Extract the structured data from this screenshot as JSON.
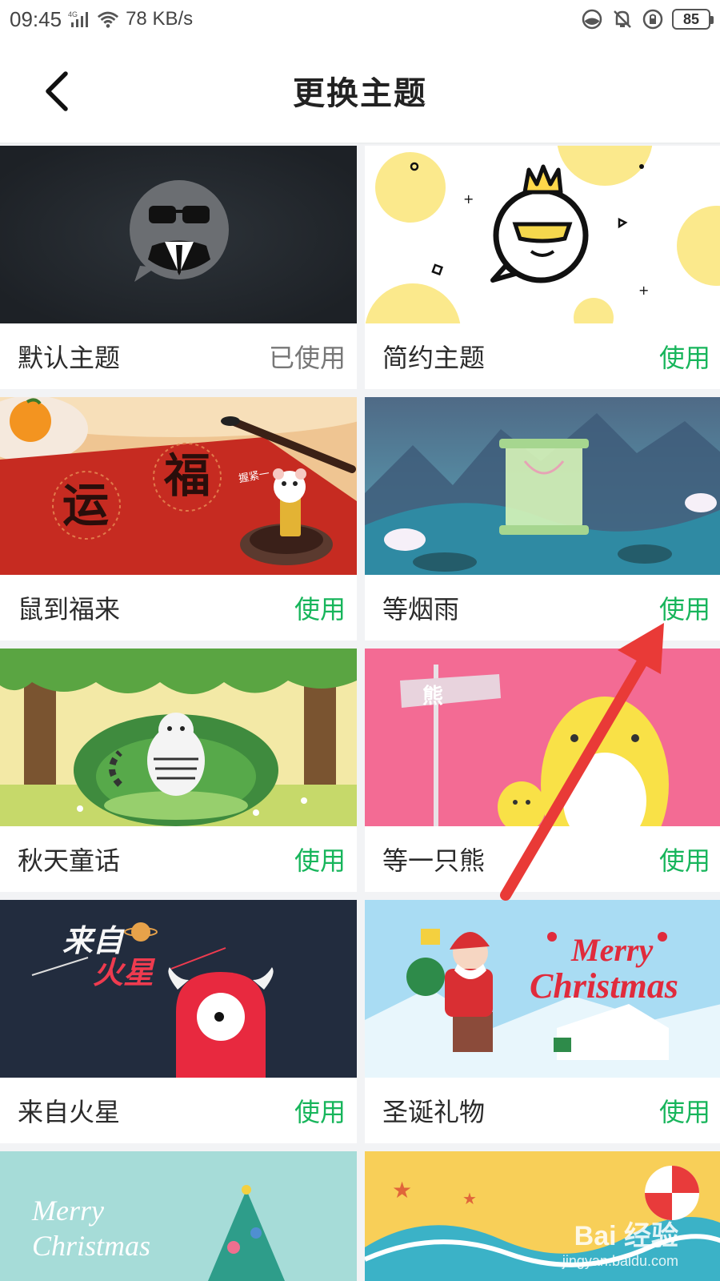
{
  "status": {
    "time": "09:45",
    "network": "4G",
    "speed": "78 KB/s",
    "battery": "85"
  },
  "header": {
    "title": "更换主题"
  },
  "themes": [
    {
      "name": "默认主题",
      "action": "已使用"
    },
    {
      "name": "简约主题",
      "action": "使用"
    },
    {
      "name": "鼠到福来",
      "action": "使用"
    },
    {
      "name": "等烟雨",
      "action": "使用"
    },
    {
      "name": "秋天童话",
      "action": "使用"
    },
    {
      "name": "等一只熊",
      "action": "使用"
    },
    {
      "name": "来自火星",
      "action": "使用"
    },
    {
      "name": "圣诞礼物",
      "action": "使用"
    }
  ],
  "thumb_text": {
    "fu_left": "运",
    "fu_right": "福",
    "brush_note": "握紧一",
    "bear_sign": "熊",
    "mars_line1": "来自",
    "mars_line2": "火星",
    "xmas_line1": "Merry",
    "xmas_line2": "Christmas",
    "xmas2_line1": "Merry",
    "xmas2_line2": "Christmas"
  },
  "watermark": {
    "logo": "Bai 经验",
    "url": "jingyan.baidu.com"
  },
  "colors": {
    "accent": "#17b55b",
    "used": "#777777"
  }
}
